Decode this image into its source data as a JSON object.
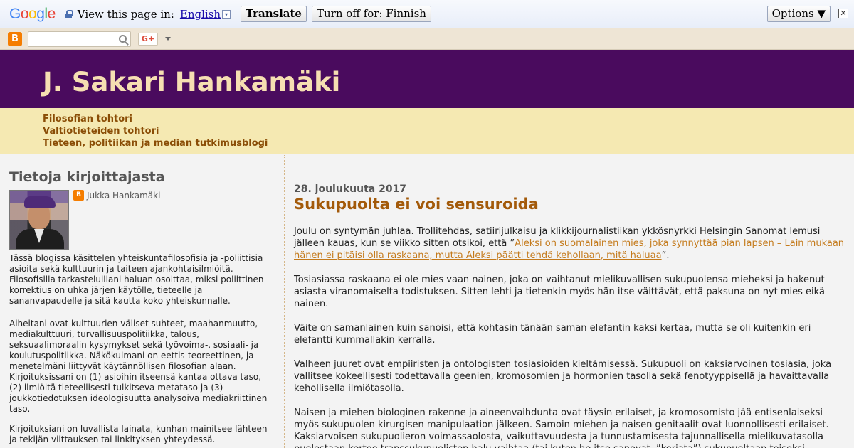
{
  "translate_bar": {
    "logo": [
      "G",
      "o",
      "o",
      "g",
      "l",
      "e"
    ],
    "prompt": "View this page in:",
    "language": "English",
    "dropdown_glyph": "▾",
    "translate_label": "Translate",
    "turn_off_label": "Turn off for: Finnish",
    "options_label": "Options ▼",
    "close_glyph": "✕"
  },
  "navbar": {
    "gplus_label": "G+",
    "search_value": ""
  },
  "blog": {
    "title": "J. Sakari Hankamäki",
    "description": [
      "Filosofian tohtori",
      "Valtiotieteiden tohtori",
      "Tieteen, politiikan ja median tutkimusblogi"
    ]
  },
  "sidebar": {
    "title": "Tietoja kirjoittajasta",
    "profile_name": "Jukka Hankamäki",
    "paragraphs": [
      "Tässä blogissa käsittelen yhteiskuntafilosofisia ja -poliittisia asioita sekä kulttuurin ja taiteen ajankohtaisilmiöitä. Filosofisilla tarkasteluillani haluan osoittaa, miksi poliittinen korrektius on uhka järjen käytölle, tieteelle ja sananvapaudelle ja sitä kautta koko yhteiskunnalle.",
      "Aiheitani ovat kulttuurien väliset suhteet, maahanmuutto, mediakulttuuri, turvallisuuspolitiikka, talous, seksuaalimoraalin kysymykset sekä työvoima-, sosiaali- ja koulutuspolitiikka. Näkökulmani on eettis-teoreettinen, ja menetelmäni liittyvät käytännöllisen filosofian alaan. Kirjoituksissani on (1) asioihin itseensä kantaa ottava taso, (2) ilmiöitä tieteellisesti tulkitseva metataso ja (3) joukkotiedotuksen ideologisuutta analysoiva mediakriittinen taso.",
      "Kirjoituksiani on luvallista lainata, kunhan mainitsee lähteen ja tekijän viittauksen tai linkityksen yhteydessä."
    ]
  },
  "post": {
    "date": "28. joulukuuta 2017",
    "title": "Sukupuolta ei voi sensuroida",
    "p1_before": "Joulu on syntymän juhlaa. Trollitehdas, satiirijulkaisu ja klikkijournalistiikan ykkösnyrkki Helsingin Sanomat lemusi jälleen kauas, kun se viikko sitten otsikoi, että ”",
    "p1_link": "Aleksi on suomalainen mies, joka synnyttää pian lapsen – Lain mukaan hänen ei pitäisi olla raskaana, mutta Aleksi päätti tehdä kehollaan, mitä haluaa",
    "p1_after": "”.",
    "p2": "Tosiasiassa raskaana ei ole mies vaan nainen, joka on vaihtanut mielikuvallisen sukupuolensa mieheksi ja hakenut asiasta viranomaiselta todistuksen. Sitten lehti ja tietenkin myös hän itse väittävät, että paksuna on nyt mies eikä nainen.",
    "p3": "Väite on samanlainen kuin sanoisi, että kohtasin tänään saman elefantin kaksi kertaa, mutta se oli kuitenkin eri elefantti kummallakin kerralla.",
    "p4": "Valheen juuret ovat empiiristen ja ontologisten tosiasioiden kieltämisessä. Sukupuoli on kaksiarvoinen tosiasia, joka vallitsee kokeellisesti todettavalla geenien, kromosomien ja hormonien tasolla sekä fenotyyppisellä ja havaittavalla kehollisella ilmiötasolla.",
    "p5": "Naisen ja miehen biologinen rakenne ja aineenvaihdunta ovat täysin erilaiset, ja kromosomisto jää entisenlaiseksi myös sukupuolen kirurgisen manipulaation jälkeen. Samoin miehen ja naisen genitaalit ovat luonnollisesti erilaiset. Kaksiarvoisen sukupuolieron voimassaolosta, vaikuttavuudesta ja tunnustamisesta tajunnallisella mielikuvatasolla puolestaan kertoo transsukupuolisten halu vaihtaa (tai kuten he itse sanovat, ”korjata”) sukupuoltaan toiseksi."
  },
  "colors": {
    "header_bg": "#4a0b5e",
    "title_color": "#f6dfb2",
    "desc_bg": "#f5e9b2",
    "post_title": "#a35a0a",
    "link": "#c47a1b"
  }
}
